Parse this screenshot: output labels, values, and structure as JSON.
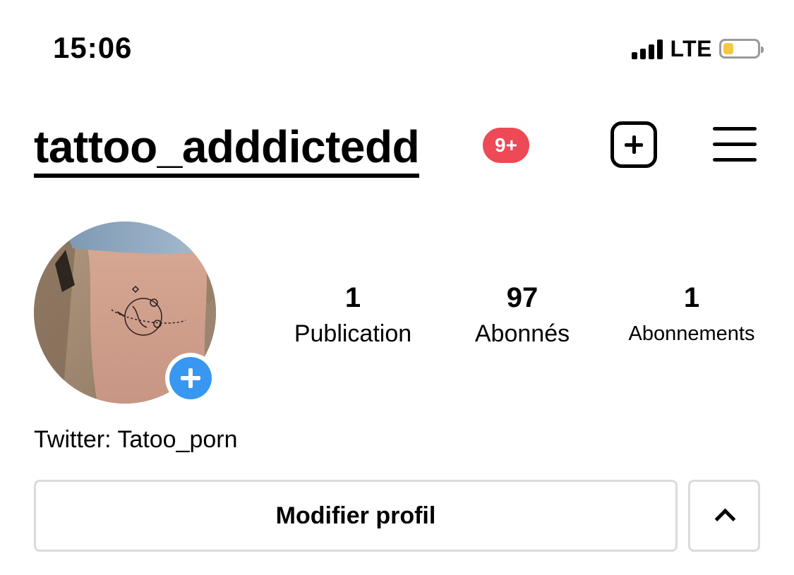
{
  "status_bar": {
    "time": "15:06",
    "network": "LTE",
    "battery_level": 0.3,
    "battery_color": "#f5c842"
  },
  "header": {
    "username": "tattoo_adddictedd",
    "notification_badge": "9+",
    "badge_color": "#ed4956",
    "new_post_icon": "plus-square-icon",
    "menu_icon": "hamburger-menu-icon"
  },
  "profile": {
    "avatar": "tattoo-photo",
    "add_story_icon": "plus-circle-icon",
    "accent_color": "#3897f0"
  },
  "stats": {
    "posts": {
      "value": "1",
      "label": "Publication"
    },
    "followers": {
      "value": "97",
      "label": "Abonnés"
    },
    "following": {
      "value": "1",
      "label": "Abonnements"
    }
  },
  "bio": {
    "text": "Twitter: Tatoo_porn"
  },
  "actions": {
    "edit_profile_label": "Modifier profil",
    "expand_icon": "chevron-up-icon"
  }
}
